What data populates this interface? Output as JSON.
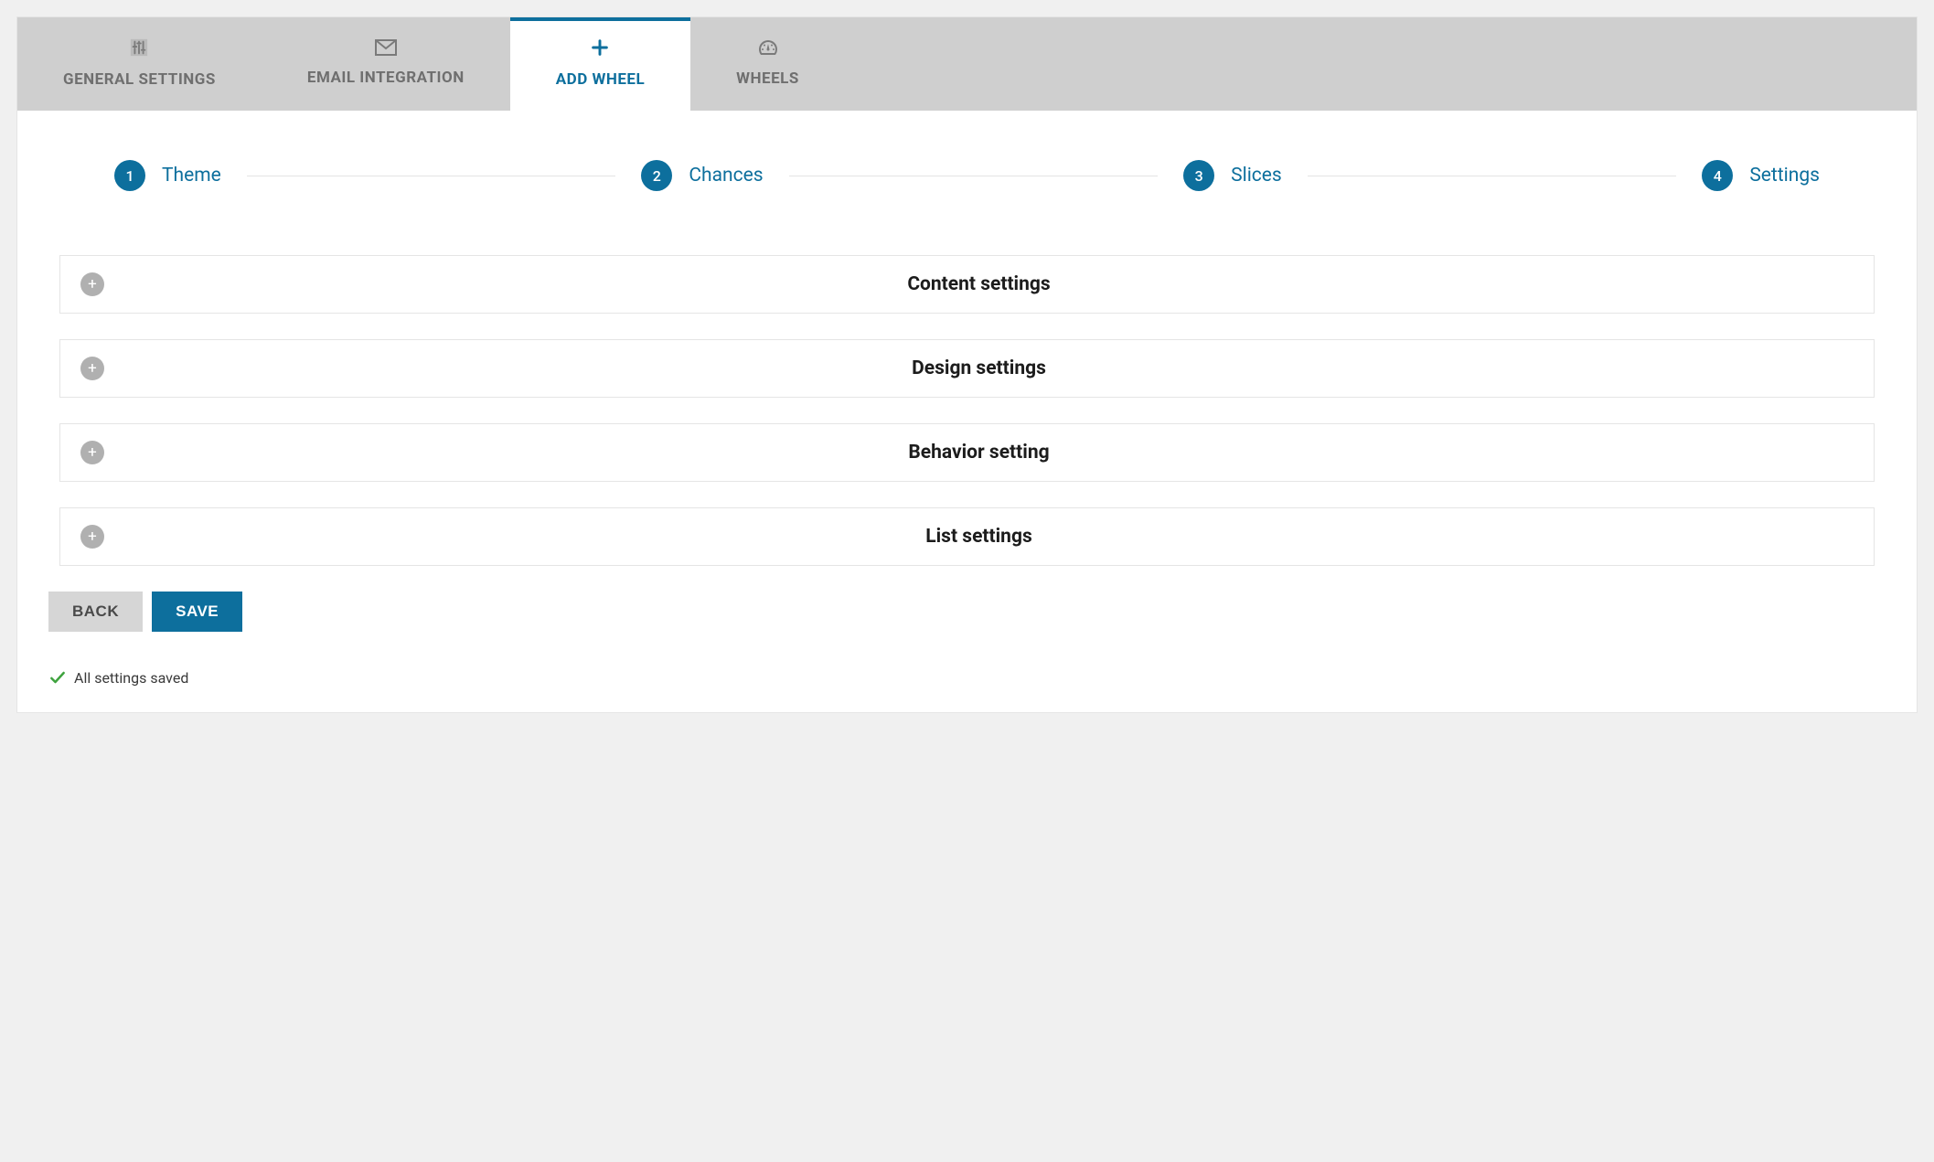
{
  "tabs": [
    {
      "label": "GENERAL SETTINGS",
      "icon": "settings"
    },
    {
      "label": "EMAIL INTEGRATION",
      "icon": "mail"
    },
    {
      "label": "ADD WHEEL",
      "icon": "plus"
    },
    {
      "label": "WHEELS",
      "icon": "gauge"
    }
  ],
  "steps": [
    {
      "num": "1",
      "label": "Theme"
    },
    {
      "num": "2",
      "label": "Chances"
    },
    {
      "num": "3",
      "label": "Slices"
    },
    {
      "num": "4",
      "label": "Settings"
    }
  ],
  "accordion": [
    {
      "title": "Content settings"
    },
    {
      "title": "Design settings"
    },
    {
      "title": "Behavior setting"
    },
    {
      "title": "List settings"
    }
  ],
  "buttons": {
    "back": "BACK",
    "save": "SAVE"
  },
  "status": {
    "message": "All settings saved"
  }
}
